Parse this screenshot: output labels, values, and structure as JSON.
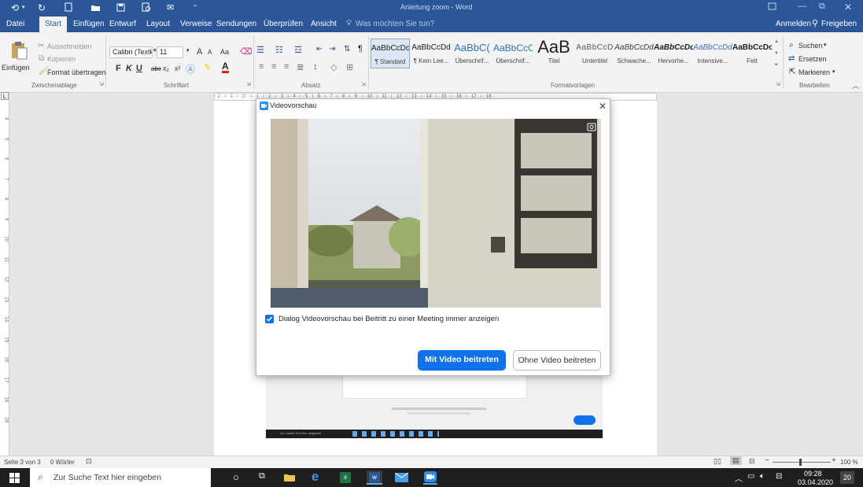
{
  "titlebar": {
    "title": "Anleitung zoom - Word",
    "colors": {
      "accent": "#2b579a"
    }
  },
  "tabs": [
    {
      "label": "Datei"
    },
    {
      "label": "Start",
      "active": true
    },
    {
      "label": "Einfügen"
    },
    {
      "label": "Entwurf"
    },
    {
      "label": "Layout"
    },
    {
      "label": "Verweise"
    },
    {
      "label": "Sendungen"
    },
    {
      "label": "Überprüfen"
    },
    {
      "label": "Ansicht"
    }
  ],
  "tellme": "Was möchten Sie tun?",
  "account": {
    "signin": "Anmelden",
    "share": "Freigeben"
  },
  "ribbon": {
    "clipboard": {
      "paste": "Einfügen",
      "cut": "Ausschneiden",
      "copy": "Kopieren",
      "format_painter": "Format übertragen",
      "label": "Zwischenablage"
    },
    "font": {
      "name": "Calibri (Textk",
      "size": "11",
      "label": "Schriftart",
      "bold": "F",
      "italic": "K",
      "underline": "U",
      "strike": "abc",
      "sub": "x₂",
      "sup": "x²",
      "grow": "A",
      "shrink": "A",
      "case": "Aa"
    },
    "paragraph": {
      "label": "Absatz"
    },
    "styles": {
      "label": "Formatvorlagen",
      "items": [
        {
          "sample": "AaBbCcDd",
          "name": "¶ Standard"
        },
        {
          "sample": "AaBbCcDd",
          "name": "¶ Kein Lee..."
        },
        {
          "sample": "AaBbC(",
          "name": "Überschrif..."
        },
        {
          "sample": "AaBbCcC",
          "name": "Überschrif..."
        },
        {
          "sample": "AaB",
          "name": "Titel"
        },
        {
          "sample": "AaBbCcD",
          "name": "Untertitel"
        },
        {
          "sample": "AaBbCcDd",
          "name": "Schwache..."
        },
        {
          "sample": "AaBbCcDd",
          "name": "Hervorhe..."
        },
        {
          "sample": "AaBbCcDd",
          "name": "Intensive..."
        },
        {
          "sample": "AaBbCcDc",
          "name": "Fett"
        }
      ]
    },
    "editing": {
      "find": "Suchen",
      "replace": "Ersetzen",
      "select": "Markieren",
      "label": "Bearbeiten"
    }
  },
  "ruler": {
    "h": "· 2 · ı · 1 · ı · ⊏ · ı · 1 · ı · 2 · ı · 3 · ı · 4 · ı · 5 · ı · 6 · ı · 7 · ı · 8 · ı · 9 · ı · 10 · ı · 11 · ı · 12 · ı · 13 · ı · 14 · ı · 15 · ı · 16 · ı · 17 · ı · 18 ·",
    "v": [
      "4",
      "5",
      "6",
      "7",
      "8",
      "9",
      "10",
      "11",
      "12",
      "13",
      "14",
      "15",
      "16",
      "17",
      "18",
      "19"
    ]
  },
  "dialog": {
    "title": "Videovorschau",
    "checkbox_label": "Dialog Videovorschau bei Beitritt zu einer Meeting immer anzeigen",
    "checkbox_checked": true,
    "primary_button": "Mit Video beitreten",
    "secondary_button": "Ohne Video beitreten",
    "colors": {
      "primary": "#0e72ed"
    }
  },
  "page_behind": {
    "search": "Zur Suche Text hier eingeben"
  },
  "statusbar": {
    "page": "Seite 3 von 3",
    "words": "0 Wörter",
    "zoom": "100 %"
  },
  "taskbar": {
    "search_placeholder": "Zur Suche Text hier eingeben",
    "time": "09:28",
    "date": "03.04.2020",
    "notifications": "20"
  }
}
